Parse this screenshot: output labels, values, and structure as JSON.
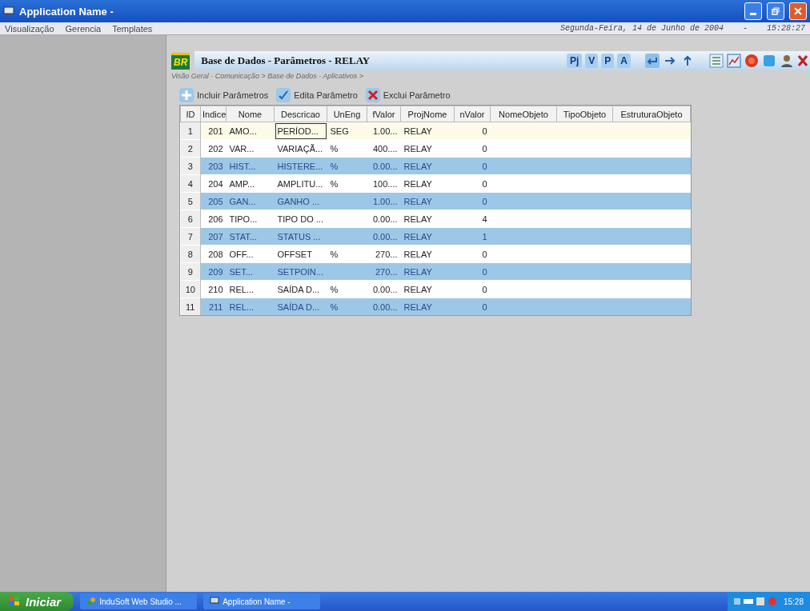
{
  "window": {
    "title": "Application Name -"
  },
  "menu": [
    "Visualização",
    "Gerencia",
    "Templates"
  ],
  "date": "Segunda-Feira, 14 de Junho de 2004",
  "date_separator": "-",
  "time": "15:28:27",
  "header": {
    "logo": "BR",
    "title": "Base de Dados - Parâmetros - RELAY",
    "text_buttons": [
      "Pj",
      "V",
      "P",
      "A"
    ]
  },
  "breadcrumb": "Visão Geral - Comunicação > Base de Dados - Aplicativos >",
  "toolbar": [
    {
      "kind": "add",
      "label": "Incluir Parâmetros"
    },
    {
      "kind": "edit",
      "label": "Edita Parâmetro"
    },
    {
      "kind": "delete",
      "label": "Exclui Parâmetro"
    }
  ],
  "table": {
    "columns": [
      "ID",
      "Indice",
      "Nome",
      "Descricao",
      "UnEng",
      "fValor",
      "ProjNome",
      "nValor",
      "NomeObjeto",
      "TipoObjeto",
      "EstruturaObjeto"
    ],
    "rows": [
      {
        "selected": false,
        "focused": true,
        "cells": [
          "1",
          "201",
          "AMO...",
          "PERÍOD...",
          "SEG",
          "1.00...",
          "RELAY",
          "0",
          "",
          "",
          ""
        ]
      },
      {
        "selected": false,
        "focused": false,
        "cells": [
          "2",
          "202",
          "VAR...",
          "VARIAÇÃ...",
          "%",
          "400....",
          "RELAY",
          "0",
          "",
          "",
          ""
        ]
      },
      {
        "selected": true,
        "focused": false,
        "cells": [
          "3",
          "203",
          "HIST...",
          "HISTERE...",
          "%",
          "0.00...",
          "RELAY",
          "0",
          "",
          "",
          ""
        ]
      },
      {
        "selected": false,
        "focused": false,
        "cells": [
          "4",
          "204",
          "AMP...",
          "AMPLITU...",
          "%",
          "100....",
          "RELAY",
          "0",
          "",
          "",
          ""
        ]
      },
      {
        "selected": true,
        "focused": false,
        "cells": [
          "5",
          "205",
          "GAN...",
          "GANHO ...",
          "",
          "1.00...",
          "RELAY",
          "0",
          "",
          "",
          ""
        ]
      },
      {
        "selected": false,
        "focused": false,
        "cells": [
          "6",
          "206",
          "TIPO...",
          "TIPO DO ...",
          "",
          "0.00...",
          "RELAY",
          "4",
          "",
          "",
          ""
        ]
      },
      {
        "selected": true,
        "focused": false,
        "cells": [
          "7",
          "207",
          "STAT...",
          "STATUS ...",
          "",
          "0.00...",
          "RELAY",
          "1",
          "",
          "",
          ""
        ]
      },
      {
        "selected": false,
        "focused": false,
        "cells": [
          "8",
          "208",
          "OFF...",
          "OFFSET",
          "%",
          "270...",
          "RELAY",
          "0",
          "",
          "",
          ""
        ]
      },
      {
        "selected": true,
        "focused": false,
        "cells": [
          "9",
          "209",
          "SET...",
          "SETPOIN...",
          "",
          "270...",
          "RELAY",
          "0",
          "",
          "",
          ""
        ]
      },
      {
        "selected": false,
        "focused": false,
        "cells": [
          "10",
          "210",
          "REL...",
          "SAÍDA D...",
          "%",
          "0.00...",
          "RELAY",
          "0",
          "",
          "",
          ""
        ]
      },
      {
        "selected": true,
        "focused": false,
        "cells": [
          "11",
          "211",
          "REL...",
          "SAÍDA D...",
          "%",
          "0.00...",
          "RELAY",
          "0",
          "",
          "",
          ""
        ]
      }
    ]
  },
  "taskbar": {
    "start": "Iniciar",
    "tasks": [
      "InduSoft Web Studio ...",
      "Application Name -"
    ],
    "clock": "15:28"
  }
}
